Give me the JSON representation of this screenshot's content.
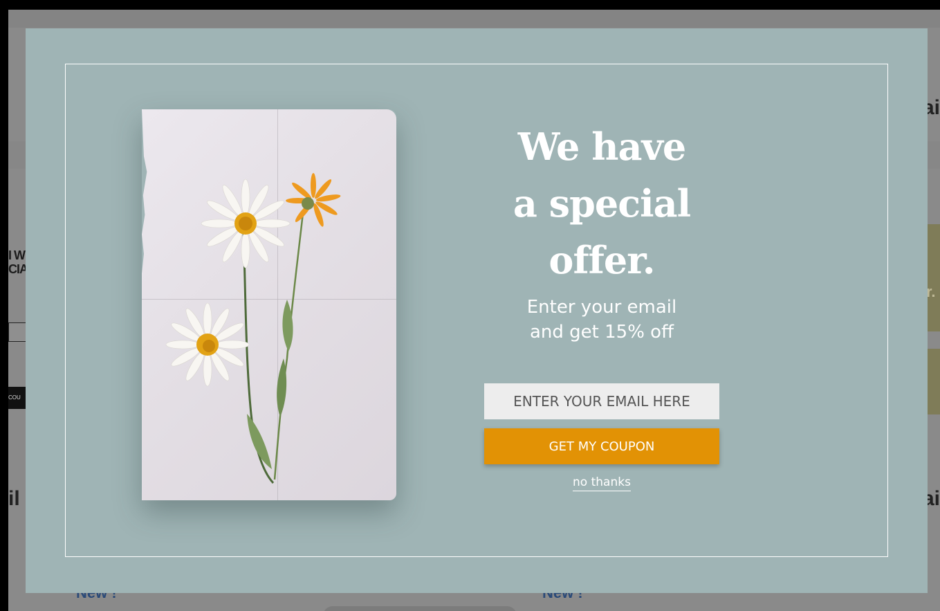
{
  "background_page": {
    "left_heading": "I WI\nCIAI",
    "left_button": "COU",
    "left_large_text": "il T",
    "right_large_text_top": "ai",
    "right_large_text_bottom": "ai",
    "right_side_text": "r.",
    "new_badge": "New !"
  },
  "modal": {
    "headline_line1": "We have",
    "headline_line2": "a special",
    "headline_line3": "offer.",
    "subhead_line1": "Enter your email",
    "subhead_line2": "and get 15% off",
    "email_placeholder": "ENTER YOUR EMAIL HERE",
    "coupon_button": "GET MY COUPON",
    "dismiss_link": "no thanks",
    "colors": {
      "modal_bg": "#9fb4b5",
      "accent": "#e29205",
      "text": "#ffffff"
    }
  }
}
